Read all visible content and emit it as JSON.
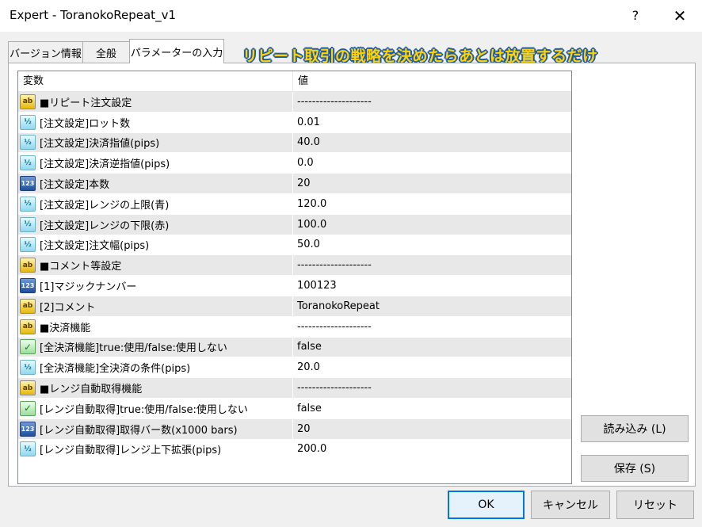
{
  "window": {
    "title": "Expert - ToranokoRepeat_v1",
    "help_label": "?",
    "close_label": "✕"
  },
  "tabs": [
    {
      "label": "バージョン情報"
    },
    {
      "label": "全般"
    },
    {
      "label": "パラメーターの入力"
    }
  ],
  "banner_text": "リピート取引の戦略を決めたらあとは放置するだけ",
  "grid": {
    "header_name": "変数",
    "header_value": "値",
    "rows": [
      {
        "icon": "ab",
        "name": "■リピート注文設定",
        "value": "--------------------"
      },
      {
        "icon": "half",
        "name": "[注文設定]ロット数",
        "value": "0.01"
      },
      {
        "icon": "half",
        "name": "[注文設定]決済指値(pips)",
        "value": "40.0"
      },
      {
        "icon": "half",
        "name": "[注文設定]決済逆指値(pips)",
        "value": "0.0"
      },
      {
        "icon": "123",
        "name": "[注文設定]本数",
        "value": "20"
      },
      {
        "icon": "half",
        "name": "[注文設定]レンジの上限(青)",
        "value": "120.0"
      },
      {
        "icon": "half",
        "name": "[注文設定]レンジの下限(赤)",
        "value": "100.0"
      },
      {
        "icon": "half",
        "name": "[注文設定]注文幅(pips)",
        "value": "50.0"
      },
      {
        "icon": "ab",
        "name": "■コメント等設定",
        "value": "--------------------"
      },
      {
        "icon": "123",
        "name": "[1]マジックナンバー",
        "value": "100123"
      },
      {
        "icon": "ab",
        "name": "[2]コメント",
        "value": "ToranokoRepeat"
      },
      {
        "icon": "ab",
        "name": "■決済機能",
        "value": "--------------------"
      },
      {
        "icon": "bool",
        "name": "[全決済機能]true:使用/false:使用しない",
        "value": "false"
      },
      {
        "icon": "half",
        "name": "[全決済機能]全決済の条件(pips)",
        "value": "20.0"
      },
      {
        "icon": "ab",
        "name": "■レンジ自動取得機能",
        "value": "--------------------"
      },
      {
        "icon": "bool",
        "name": "[レンジ自動取得]true:使用/false:使用しない",
        "value": "false"
      },
      {
        "icon": "123",
        "name": "[レンジ自動取得]取得バー数(x1000 bars)",
        "value": "20"
      },
      {
        "icon": "half",
        "name": "[レンジ自動取得]レンジ上下拡張(pips)",
        "value": "200.0"
      }
    ]
  },
  "icon_glyphs": {
    "ab": "ab",
    "half": "½",
    "123": "123",
    "bool": "✓"
  },
  "buttons": {
    "load": "読み込み (L)",
    "save": "保存 (S)",
    "ok": "OK",
    "cancel": "キャンセル",
    "reset": "リセット"
  }
}
